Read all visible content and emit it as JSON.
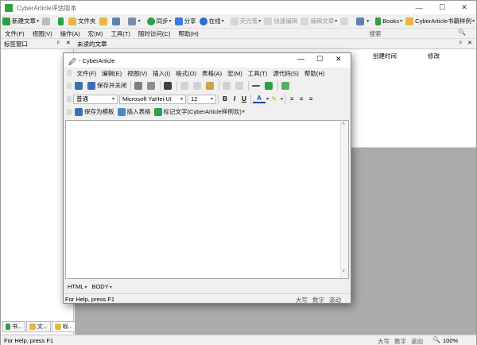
{
  "window": {
    "title": "CyberArticle评估版本"
  },
  "toolbar": {
    "new_article": "新建文章",
    "folder": "文件夹",
    "sync": "同步",
    "share": "分享",
    "online": "在线",
    "highlighter": "荧光笔",
    "quick_edit": "快速编辑",
    "edit_article": "编辑文章",
    "books": "Books",
    "library_sample": "CyberArticle书籍样例"
  },
  "menu": [
    "文件(F)",
    "视图(V)",
    "操作(A)",
    "宏(M)",
    "工具(T)",
    "随时访问(C)",
    "帮助(H)"
  ],
  "search": {
    "placeholder": "搜索"
  },
  "panes": {
    "label_window": "标签窗口",
    "unread_articles": "未读的文章",
    "list_columns": [
      "创建时间",
      "修改"
    ]
  },
  "left_tabs": [
    "书...",
    "文...",
    "标..."
  ],
  "child": {
    "title": "- CyberArticle",
    "menu": [
      "文件(F)",
      "编辑(E)",
      "视图(V)",
      "插入(I)",
      "格式(O)",
      "表格(A)",
      "宏(M)",
      "工具(T)",
      "源代码(S)",
      "帮助(H)"
    ],
    "save_close": "保存并关闭",
    "style_value": "普通",
    "font_value": "Microsoft YaHei UI",
    "size_value": "12",
    "save_template": "保存为模板",
    "insert_table": "插入表格",
    "mark_text": "标记文字(CyberArticle样例欢)",
    "tags": [
      "HTML",
      "BODY"
    ],
    "status_help": "For Help, press F1",
    "status_caps": "大写",
    "status_num": "数字",
    "status_scroll": "滚动"
  },
  "status": {
    "help": "For Help, press F1",
    "caps": "大写",
    "num": "数字",
    "scroll": "滚动",
    "zoom": "100%"
  },
  "colors": {
    "accent_green": "#2f9e44",
    "accent_blue": "#2b6cd4",
    "folder_yellow": "#e9b640",
    "workspace_gray": "#ababab"
  }
}
